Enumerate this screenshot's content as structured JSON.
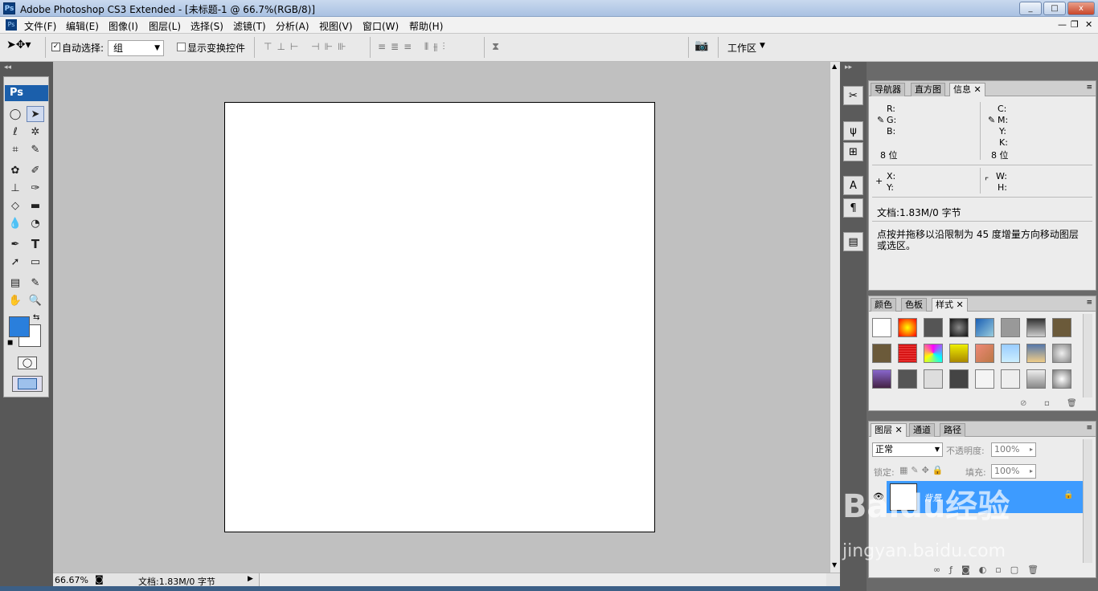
{
  "window": {
    "app_icon": "Ps",
    "title": "Adobe Photoshop CS3 Extended - [未标题-1 @ 66.7%(RGB/8)]",
    "controls": [
      "_",
      "□",
      "x"
    ]
  },
  "menu": {
    "items": [
      "文件(F)",
      "编辑(E)",
      "图像(I)",
      "图层(L)",
      "选择(S)",
      "滤镜(T)",
      "分析(A)",
      "视图(V)",
      "窗口(W)",
      "帮助(H)"
    ]
  },
  "options": {
    "auto_select_label": "自动选择:",
    "auto_select_value": "组",
    "show_transform_label": "显示变换控件",
    "workspace_label": "工作区"
  },
  "toolbox": {
    "logo": "Ps",
    "foreground_color": "#2a7fdc",
    "background_color": "#ffffff"
  },
  "info_panel": {
    "tabs": [
      "导航器",
      "直方图",
      "信息"
    ],
    "r_label": "R:",
    "g_label": "G:",
    "b_label": "B:",
    "c_label": "C:",
    "m_label": "M:",
    "y_label": "Y:",
    "k_label": "K:",
    "bitdepth_left": "8 位",
    "bitdepth_right": "8 位",
    "x_label": "X:",
    "y2_label": "Y:",
    "w_label": "W:",
    "h_label": "H:",
    "doc_info": "文档:1.83M/0 字节",
    "hint": "点按并拖移以沿限制为 45 度增量方向移动图层或选区。"
  },
  "styles_panel": {
    "tabs": [
      "颜色",
      "色板",
      "样式"
    ]
  },
  "layers_panel": {
    "tabs": [
      "图层",
      "通道",
      "路径"
    ],
    "blend_mode": "正常",
    "opacity_label": "不透明度:",
    "opacity_value": "100%",
    "lock_label": "锁定:",
    "fill_label": "填充:",
    "fill_value": "100%",
    "layer_name": "背景"
  },
  "status": {
    "zoom": "66.67%",
    "doc_info": "文档:1.83M/0 字节"
  },
  "watermark": {
    "brand": "Baidu经验",
    "url": "jingyan.baidu.com"
  }
}
